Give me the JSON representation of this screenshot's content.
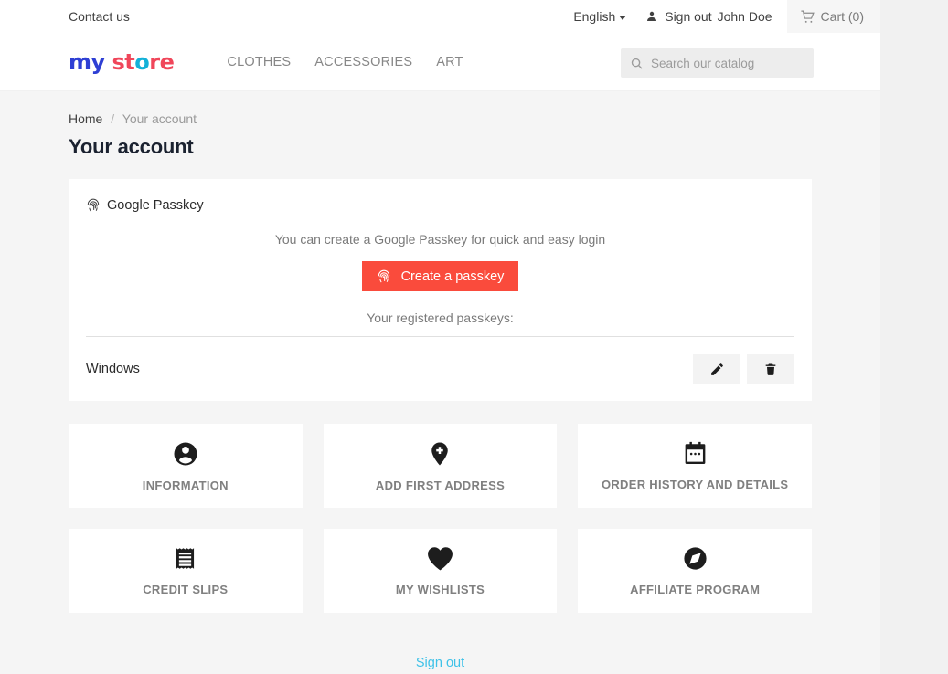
{
  "topbar": {
    "contact_label": "Contact us",
    "language": "English",
    "signout_label": "Sign out",
    "user_name": "John Doe",
    "cart_label": "Cart (0)",
    "cart_count": 0
  },
  "header": {
    "logo": {
      "part1": "my",
      "part2": "st",
      "part3": "o",
      "part4": "re"
    },
    "menu": [
      {
        "label": "CLOTHES"
      },
      {
        "label": "ACCESSORIES"
      },
      {
        "label": "ART"
      }
    ],
    "search": {
      "placeholder": "Search our catalog",
      "value": ""
    }
  },
  "breadcrumb": {
    "home": "Home",
    "separator": "/",
    "current": "Your account"
  },
  "page": {
    "title": "Your account"
  },
  "passkey": {
    "section_title": "Google Passkey",
    "description": "You can create a Google Passkey for quick and easy login",
    "create_button": "Create a passkey",
    "registered_label": "Your registered passkeys:",
    "entries": [
      {
        "name": "Windows",
        "edit_label": "Edit",
        "delete_label": "Delete"
      }
    ]
  },
  "tiles": [
    {
      "label": "INFORMATION",
      "icon": "account-circle-icon"
    },
    {
      "label": "ADD FIRST ADDRESS",
      "icon": "add-location-icon"
    },
    {
      "label": "ORDER HISTORY AND DETAILS",
      "icon": "calendar-icon"
    },
    {
      "label": "CREDIT SLIPS",
      "icon": "receipt-icon"
    },
    {
      "label": "MY WISHLISTS",
      "icon": "heart-icon"
    },
    {
      "label": "AFFILIATE PROGRAM",
      "icon": "compass-icon"
    }
  ],
  "footer": {
    "signout_label": "Sign out"
  },
  "colors": {
    "accent_red": "#fa4b3c",
    "link_blue": "#3fc2e8",
    "page_bg": "#f5f5f5",
    "card_bg": "#ffffff"
  }
}
